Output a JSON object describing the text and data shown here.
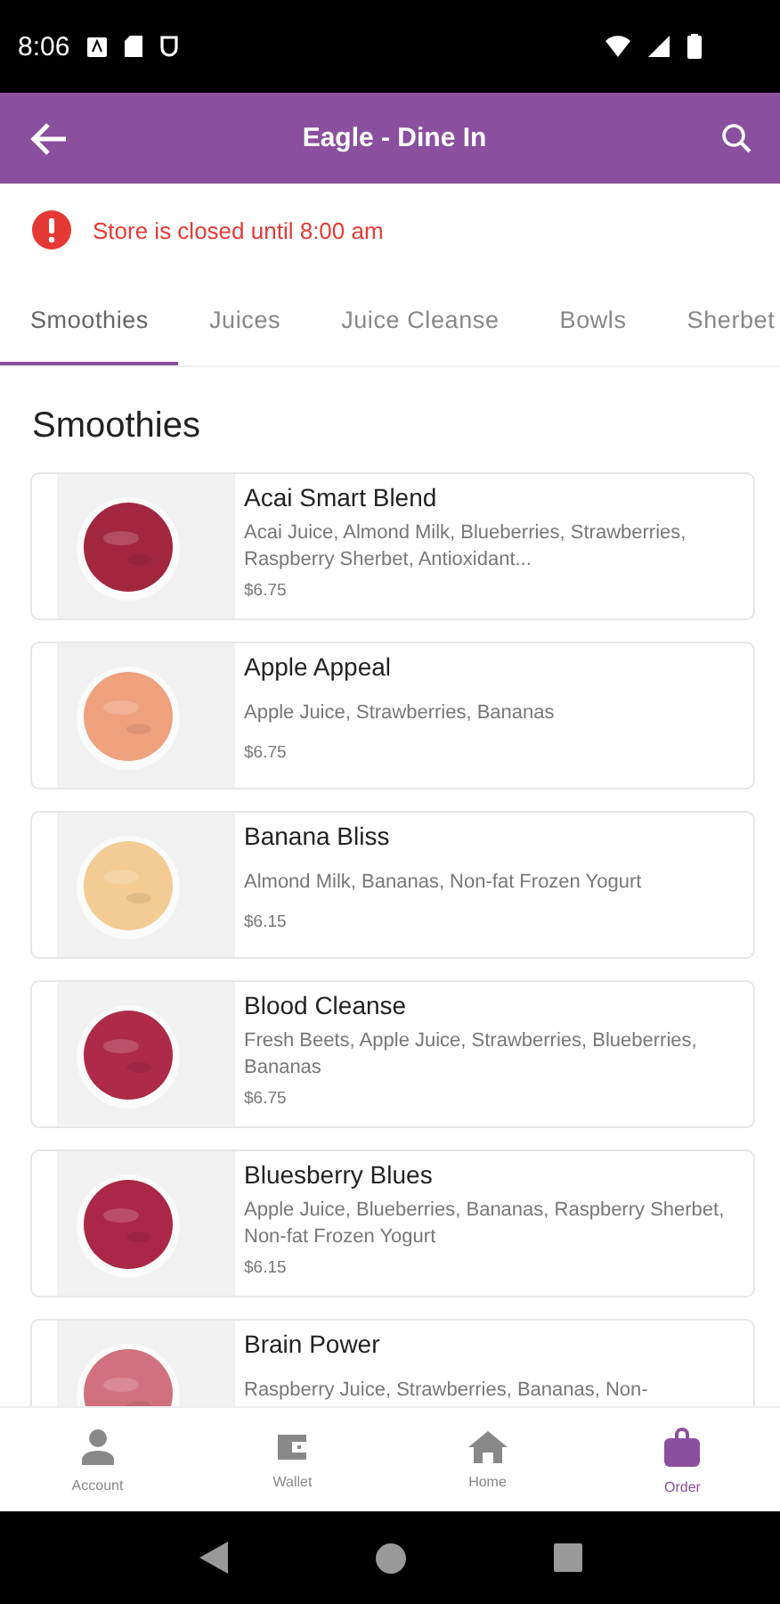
{
  "status_bar": {
    "time": "8:06"
  },
  "app_bar": {
    "title": "Eagle - Dine In"
  },
  "alert": {
    "message": "Store is closed until 8:00 am"
  },
  "tabs": [
    {
      "label": "Smoothies",
      "selected": true
    },
    {
      "label": "Juices",
      "selected": false
    },
    {
      "label": "Juice Cleanse",
      "selected": false
    },
    {
      "label": "Bowls",
      "selected": false
    },
    {
      "label": "Sherbet",
      "selected": false
    }
  ],
  "section_title": "Smoothies",
  "products": [
    {
      "name": "Acai Smart Blend",
      "description": "Acai Juice, Almond Milk, Blueberries, Strawberries, Raspberry Sherbet, Antioxidant...",
      "price": "$6.75",
      "color": "#a3263f"
    },
    {
      "name": "Apple Appeal",
      "description": "Apple Juice, Strawberries, Bananas",
      "price": "$6.75",
      "color": "#efa17e"
    },
    {
      "name": "Banana Bliss",
      "description": "Almond Milk, Bananas, Non-fat Frozen Yogurt",
      "price": "$6.15",
      "color": "#f2cc93"
    },
    {
      "name": "Blood Cleanse",
      "description": "Fresh Beets, Apple Juice, Strawberries, Blueberries, Bananas",
      "price": "$6.75",
      "color": "#ad2a48"
    },
    {
      "name": "Bluesberry Blues",
      "description": "Apple Juice, Blueberries, Bananas, Raspberry Sherbet, Non-fat Frozen Yogurt",
      "price": "$6.15",
      "color": "#ab2747"
    },
    {
      "name": "Brain Power",
      "description": "Raspberry Juice, Strawberries, Bananas, Non-",
      "color": "#d1717f"
    }
  ],
  "bottom_nav": [
    {
      "label": "Account",
      "kind": "person",
      "selected": false
    },
    {
      "label": "Wallet",
      "kind": "wallet",
      "selected": false
    },
    {
      "label": "Home",
      "kind": "home",
      "selected": false
    },
    {
      "label": "Order",
      "kind": "bag",
      "selected": true
    }
  ]
}
